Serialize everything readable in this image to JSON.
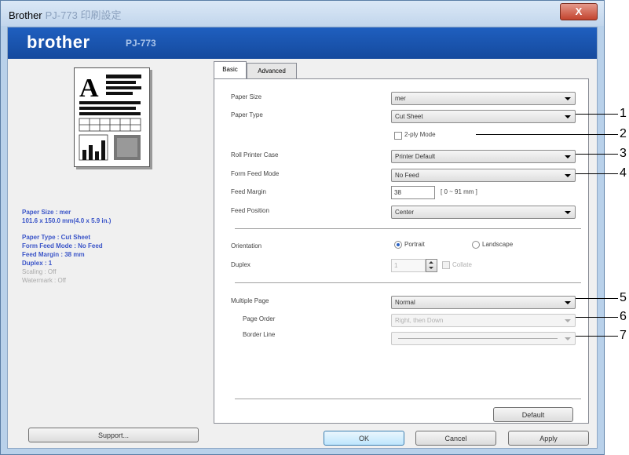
{
  "window": {
    "title": "Brother",
    "title_suffix": "PJ-773 印刷設定",
    "close_label": "X"
  },
  "banner": {
    "logo": "brother",
    "model": "PJ-773"
  },
  "preview": {
    "letter": "A"
  },
  "summary": [
    {
      "text": "Paper Size : mer",
      "style": "blue"
    },
    {
      "text": "101.6 x 150.0 mm(4.0 x 5.9 in.)",
      "style": "blue"
    },
    {
      "text": "Paper Type : Cut Sheet",
      "style": "blue"
    },
    {
      "text": "Form Feed Mode : No Feed",
      "style": "blue"
    },
    {
      "text": "Feed Margin : 38 mm",
      "style": "blue"
    },
    {
      "text": "Duplex : 1",
      "style": "blue"
    },
    {
      "text": "Scaling : Off",
      "style": "grey"
    },
    {
      "text": "Watermark : Off",
      "style": "grey"
    }
  ],
  "buttons": {
    "support": "Support...",
    "default": "Default",
    "ok": "OK",
    "cancel": "Cancel",
    "apply": "Apply"
  },
  "tabs": [
    {
      "label": "Basic",
      "active": true
    },
    {
      "label": "Advanced",
      "active": false
    }
  ],
  "basic": {
    "paper_size": {
      "label": "Paper Size",
      "value": "mer"
    },
    "paper_type": {
      "label": "Paper Type",
      "value": "Cut Sheet"
    },
    "two_ply_mode": {
      "label": "2-ply Mode",
      "checked": false
    },
    "roll_printer_case": {
      "label": "Roll Printer Case",
      "value": "Printer Default"
    },
    "form_feed_mode": {
      "label": "Form Feed Mode",
      "value": "No Feed"
    },
    "feed_margin": {
      "label": "Feed Margin",
      "value": "38",
      "range": "[ 0 ~ 91 mm ]"
    },
    "feed_position": {
      "label": "Feed Position",
      "value": "Center"
    },
    "orientation": {
      "label": "Orientation",
      "options": [
        "Portrait",
        "Landscape"
      ],
      "selected": "Portrait"
    },
    "duplex": {
      "label": "Duplex",
      "value": "1",
      "collate_label": "Collate"
    },
    "multiple_page": {
      "label": "Multiple Page",
      "value": "Normal"
    },
    "page_order": {
      "label": "Page Order",
      "value": "Right, then Down"
    },
    "border_line": {
      "label": "Border Line",
      "value": ""
    }
  },
  "callouts": [
    "1",
    "2",
    "3",
    "4",
    "5",
    "6",
    "7"
  ]
}
